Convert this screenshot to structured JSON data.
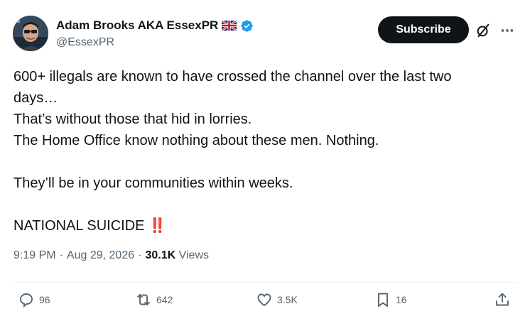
{
  "author": {
    "display_name": "Adam Brooks AKA EssexPR",
    "handle": "@EssexPR",
    "flag_icon": "uk-flag-icon",
    "verified_icon": "verified-badge-icon",
    "verified_color": "#1d9bf0"
  },
  "header": {
    "subscribe_label": "Subscribe",
    "grok_icon": "grok-icon",
    "more_icon": "more-dots-icon"
  },
  "tweet": {
    "text": "600+ illegals are known to have crossed the channel over the last two\ndays…\nThat’s without those that hid in lorries.\nThe Home Office know nothing about these men. Nothing.\n\nThey’ll be in your communities within weeks.\n\nNATIONAL SUICIDE ",
    "emoji": "‼️",
    "emoji_color": "#e0245e"
  },
  "meta": {
    "time": "9:19 PM",
    "separator": "·",
    "date": "Aug 29, 2026",
    "views_count": "30.1K",
    "views_label": "Views"
  },
  "actions": {
    "replies": "96",
    "reposts": "642",
    "likes": "3.5K",
    "bookmarks": "16"
  },
  "colors": {
    "text_primary": "#0f1419",
    "text_secondary": "#536471",
    "button_dark": "#0f1419"
  }
}
